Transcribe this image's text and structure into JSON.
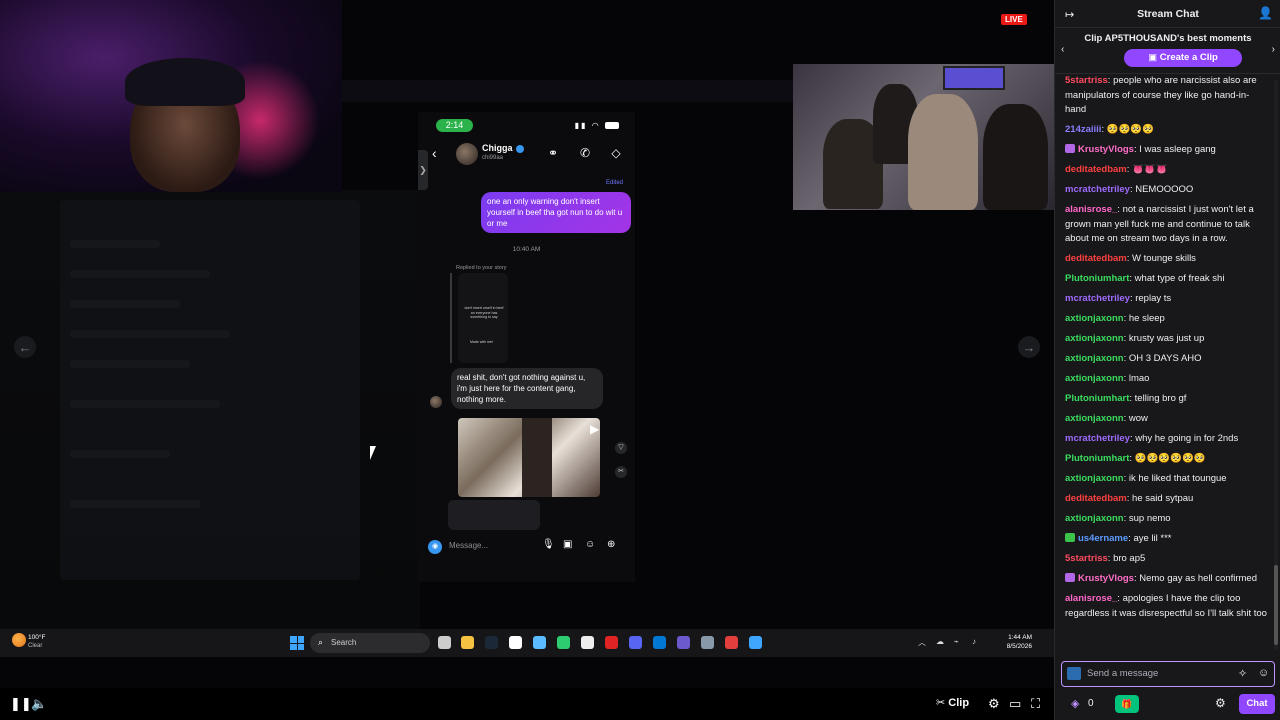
{
  "stream": {
    "live_label": "LIVE",
    "phone": {
      "time": "2:14",
      "contact_name": "Chigga",
      "contact_handle": "chi99aa",
      "edited_label": "Edited",
      "outgoing_message": "one an only warning don't insert yourself in beef tha got nun to do wit u or me",
      "message_time": "10:40 AM",
      "replied_label": "Replied to your story",
      "story_text": "don't insert urself in beef an everyone has something to say",
      "story_caption": "Made with reel",
      "incoming_message": "real shit, don't got nothing against u, i'm just here for the content gang, nothing more.",
      "composer_placeholder": "Message..."
    },
    "taskbar": {
      "weather_temp": "100°F",
      "weather_condition": "Clear",
      "search_label": "Search",
      "clock_time": "1:44 AM",
      "clock_date": "8/5/2026"
    },
    "controls": {
      "clip_label": "Clip"
    }
  },
  "chat": {
    "title": "Stream Chat",
    "clip_banner_title": "Clip AP5THOUSAND's best moments",
    "create_clip_label": "Create a Clip",
    "input_placeholder": "Send a message",
    "points": "0",
    "send_label": "Chat",
    "messages": [
      {
        "user": "5startriss",
        "color": "#ff4a5f",
        "text": "people who are narcissist also are manipulators of course they like go hand-in-hand"
      },
      {
        "user": "214zaiiii",
        "color": "#8a7dff",
        "text": "🥺🥺🥺🥺"
      },
      {
        "user": "KrustyVlogs",
        "color": "#ff6ec7",
        "text": "I was asleep gang",
        "badge": "#b267e6"
      },
      {
        "user": "deditatedbam",
        "color": "#ff4040",
        "text": "👅👅👅"
      },
      {
        "user": "mcratchetriley",
        "color": "#9f6bff",
        "text": "NEMOOOOO"
      },
      {
        "user": "alanisrose_",
        "color": "#ff67c8",
        "text": "not a narcissist I just won't let a grown man yell fuck me and continue to talk about me on stream two days in a row."
      },
      {
        "user": "deditatedbam",
        "color": "#ff4040",
        "text": "W tounge skills"
      },
      {
        "user": "Plutoniumhart",
        "color": "#3bdc5e",
        "text": "what type of freak shi"
      },
      {
        "user": "mcratchetriley",
        "color": "#9f6bff",
        "text": "replay ts"
      },
      {
        "user": "axtionjaxonn",
        "color": "#3bdc5e",
        "text": "he sleep"
      },
      {
        "user": "axtionjaxonn",
        "color": "#3bdc5e",
        "text": "krusty was just up"
      },
      {
        "user": "axtionjaxonn",
        "color": "#3bdc5e",
        "text": "OH 3 DAYS AHO"
      },
      {
        "user": "axtionjaxonn",
        "color": "#3bdc5e",
        "text": "lmao"
      },
      {
        "user": "Plutoniumhart",
        "color": "#3bdc5e",
        "text": "telling bro gf"
      },
      {
        "user": "axtionjaxonn",
        "color": "#3bdc5e",
        "text": "wow"
      },
      {
        "user": "mcratchetriley",
        "color": "#9f6bff",
        "text": "why he going in for 2nds"
      },
      {
        "user": "Plutoniumhart",
        "color": "#3bdc5e",
        "text": "🥺🥺🥺🥺🥺🥺"
      },
      {
        "user": "axtionjaxonn",
        "color": "#3bdc5e",
        "text": "ik he liked that toungue"
      },
      {
        "user": "deditatedbam",
        "color": "#ff4040",
        "text": "he said sytpau"
      },
      {
        "user": "axtionjaxonn",
        "color": "#3bdc5e",
        "text": "sup nemo"
      },
      {
        "user": "us4ername",
        "color": "#5b9bff",
        "text": "aye lil ***",
        "badge": "#3bc24a"
      },
      {
        "user": "5startriss",
        "color": "#ff4a5f",
        "text": "bro ap5"
      },
      {
        "user": "KrustyVlogs",
        "color": "#ff6ec7",
        "text": "Nemo gay as hell confirmed",
        "badge": "#b267e6"
      },
      {
        "user": "alanisrose_",
        "color": "#ff67c8",
        "text": "apologies I have the clip too regardless it was disrespectful so I'll talk shit too"
      }
    ]
  }
}
